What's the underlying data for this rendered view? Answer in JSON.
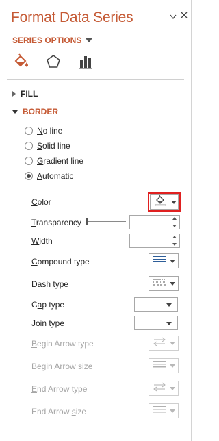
{
  "panel": {
    "title": "Format Data Series",
    "series_options_label": "SERIES OPTIONS"
  },
  "tabs": [
    {
      "name": "fill-line-icon"
    },
    {
      "name": "effects-icon"
    },
    {
      "name": "series-options-icon"
    }
  ],
  "sections": {
    "fill_label": "FILL",
    "border_label": "BORDER"
  },
  "border_options": [
    {
      "pre": "",
      "accel": "N",
      "post": "o line",
      "selected": false
    },
    {
      "pre": "",
      "accel": "S",
      "post": "olid line",
      "selected": false
    },
    {
      "pre": "",
      "accel": "G",
      "post": "radient line",
      "selected": false
    },
    {
      "pre": "",
      "accel": "A",
      "post": "utomatic",
      "selected": true
    }
  ],
  "properties": {
    "color": {
      "pre": "",
      "accel": "C",
      "post": "olor"
    },
    "transparency": {
      "pre": "",
      "accel": "T",
      "post": "ransparency",
      "value": ""
    },
    "width": {
      "pre": "",
      "accel": "W",
      "post": "idth",
      "value": ""
    },
    "compound_type": {
      "pre": "",
      "accel": "C",
      "post": "ompound type"
    },
    "dash_type": {
      "pre": "",
      "accel": "D",
      "post": "ash type"
    },
    "cap_type": {
      "pre": "C",
      "accel": "a",
      "post": "p type"
    },
    "join_type": {
      "pre": "",
      "accel": "J",
      "post": "oin type"
    },
    "begin_arrow_type": {
      "pre": "",
      "accel": "B",
      "post": "egin Arrow type"
    },
    "begin_arrow_size": {
      "pre": "Begin Arrow ",
      "accel": "s",
      "post": "ize"
    },
    "end_arrow_type": {
      "pre": "",
      "accel": "E",
      "post": "nd Arrow type"
    },
    "end_arrow_size": {
      "pre": "End Arrow ",
      "accel": "s",
      "post": "ize"
    }
  },
  "colors": {
    "accent": "#c55a35",
    "highlight": "#e02020",
    "disabled": "#a6a6a6"
  }
}
